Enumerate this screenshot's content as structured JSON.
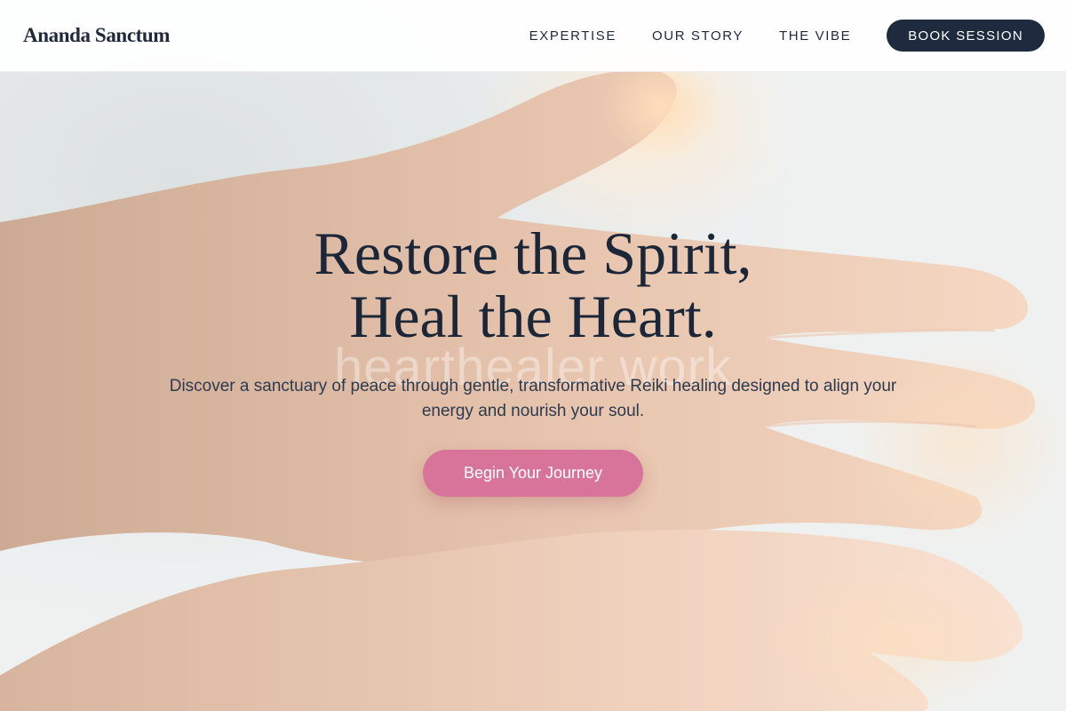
{
  "brand": {
    "name": "Ananda Sanctum"
  },
  "nav": {
    "items": [
      {
        "label": "EXPERTISE"
      },
      {
        "label": "OUR STORY"
      },
      {
        "label": "THE VIBE"
      }
    ],
    "book_label": "BOOK SESSION"
  },
  "hero": {
    "title_line1": "Restore the Spirit,",
    "title_line2": "Heal the Heart.",
    "watermark": "hearthealer work",
    "subtitle": "Discover a sanctuary of peace through gentle, transformative Reiki healing designed to align your energy and nourish your soul.",
    "cta_label": "Begin Your Journey"
  },
  "colors": {
    "navy": "#1e2a3d",
    "accent_pink": "#d8749a",
    "text_dark": "#1b2638"
  }
}
